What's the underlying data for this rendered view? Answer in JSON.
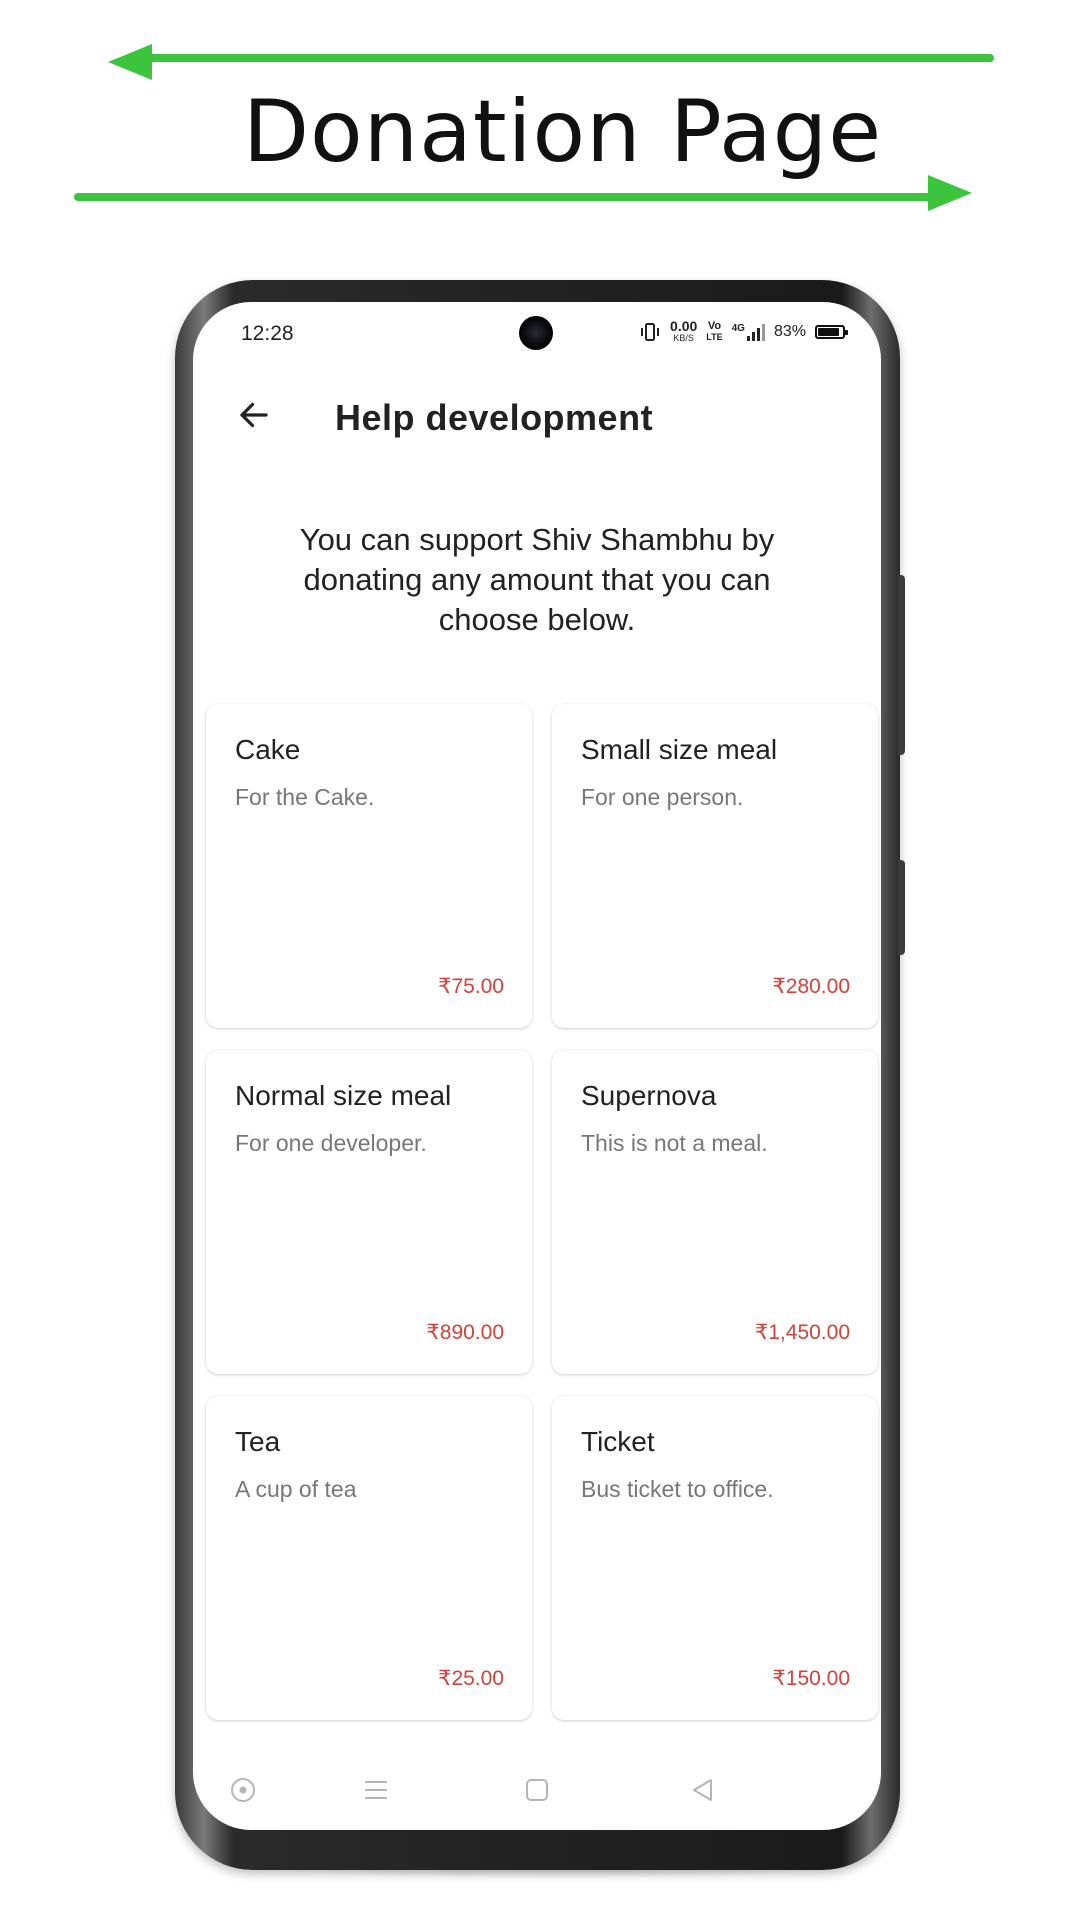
{
  "banner": {
    "title": "Donation Page"
  },
  "status_bar": {
    "time": "12:28",
    "net_speed": "0.00",
    "net_unit": "KB/S",
    "volte_top": "Vo",
    "volte_bottom": "LTE",
    "network": "4G",
    "battery": "83%"
  },
  "app_bar": {
    "title": "Help development"
  },
  "intro_text": "You can support Shiv Shambhu by donating any amount that you can choose below.",
  "donation_items": [
    {
      "title": "Cake",
      "subtitle": "For the Cake.",
      "price": "₹75.00"
    },
    {
      "title": "Small size meal",
      "subtitle": "For one person.",
      "price": "₹280.00"
    },
    {
      "title": "Normal size meal",
      "subtitle": "For one developer.",
      "price": "₹890.00"
    },
    {
      "title": "Supernova",
      "subtitle": "This is not a meal.",
      "price": "₹1,450.00"
    },
    {
      "title": "Tea",
      "subtitle": "A cup of tea",
      "price": "₹25.00"
    },
    {
      "title": "Ticket",
      "subtitle": "Bus ticket to office.",
      "price": "₹150.00"
    }
  ],
  "colors": {
    "arrow": "#3cc43c",
    "price": "#d4433a"
  }
}
